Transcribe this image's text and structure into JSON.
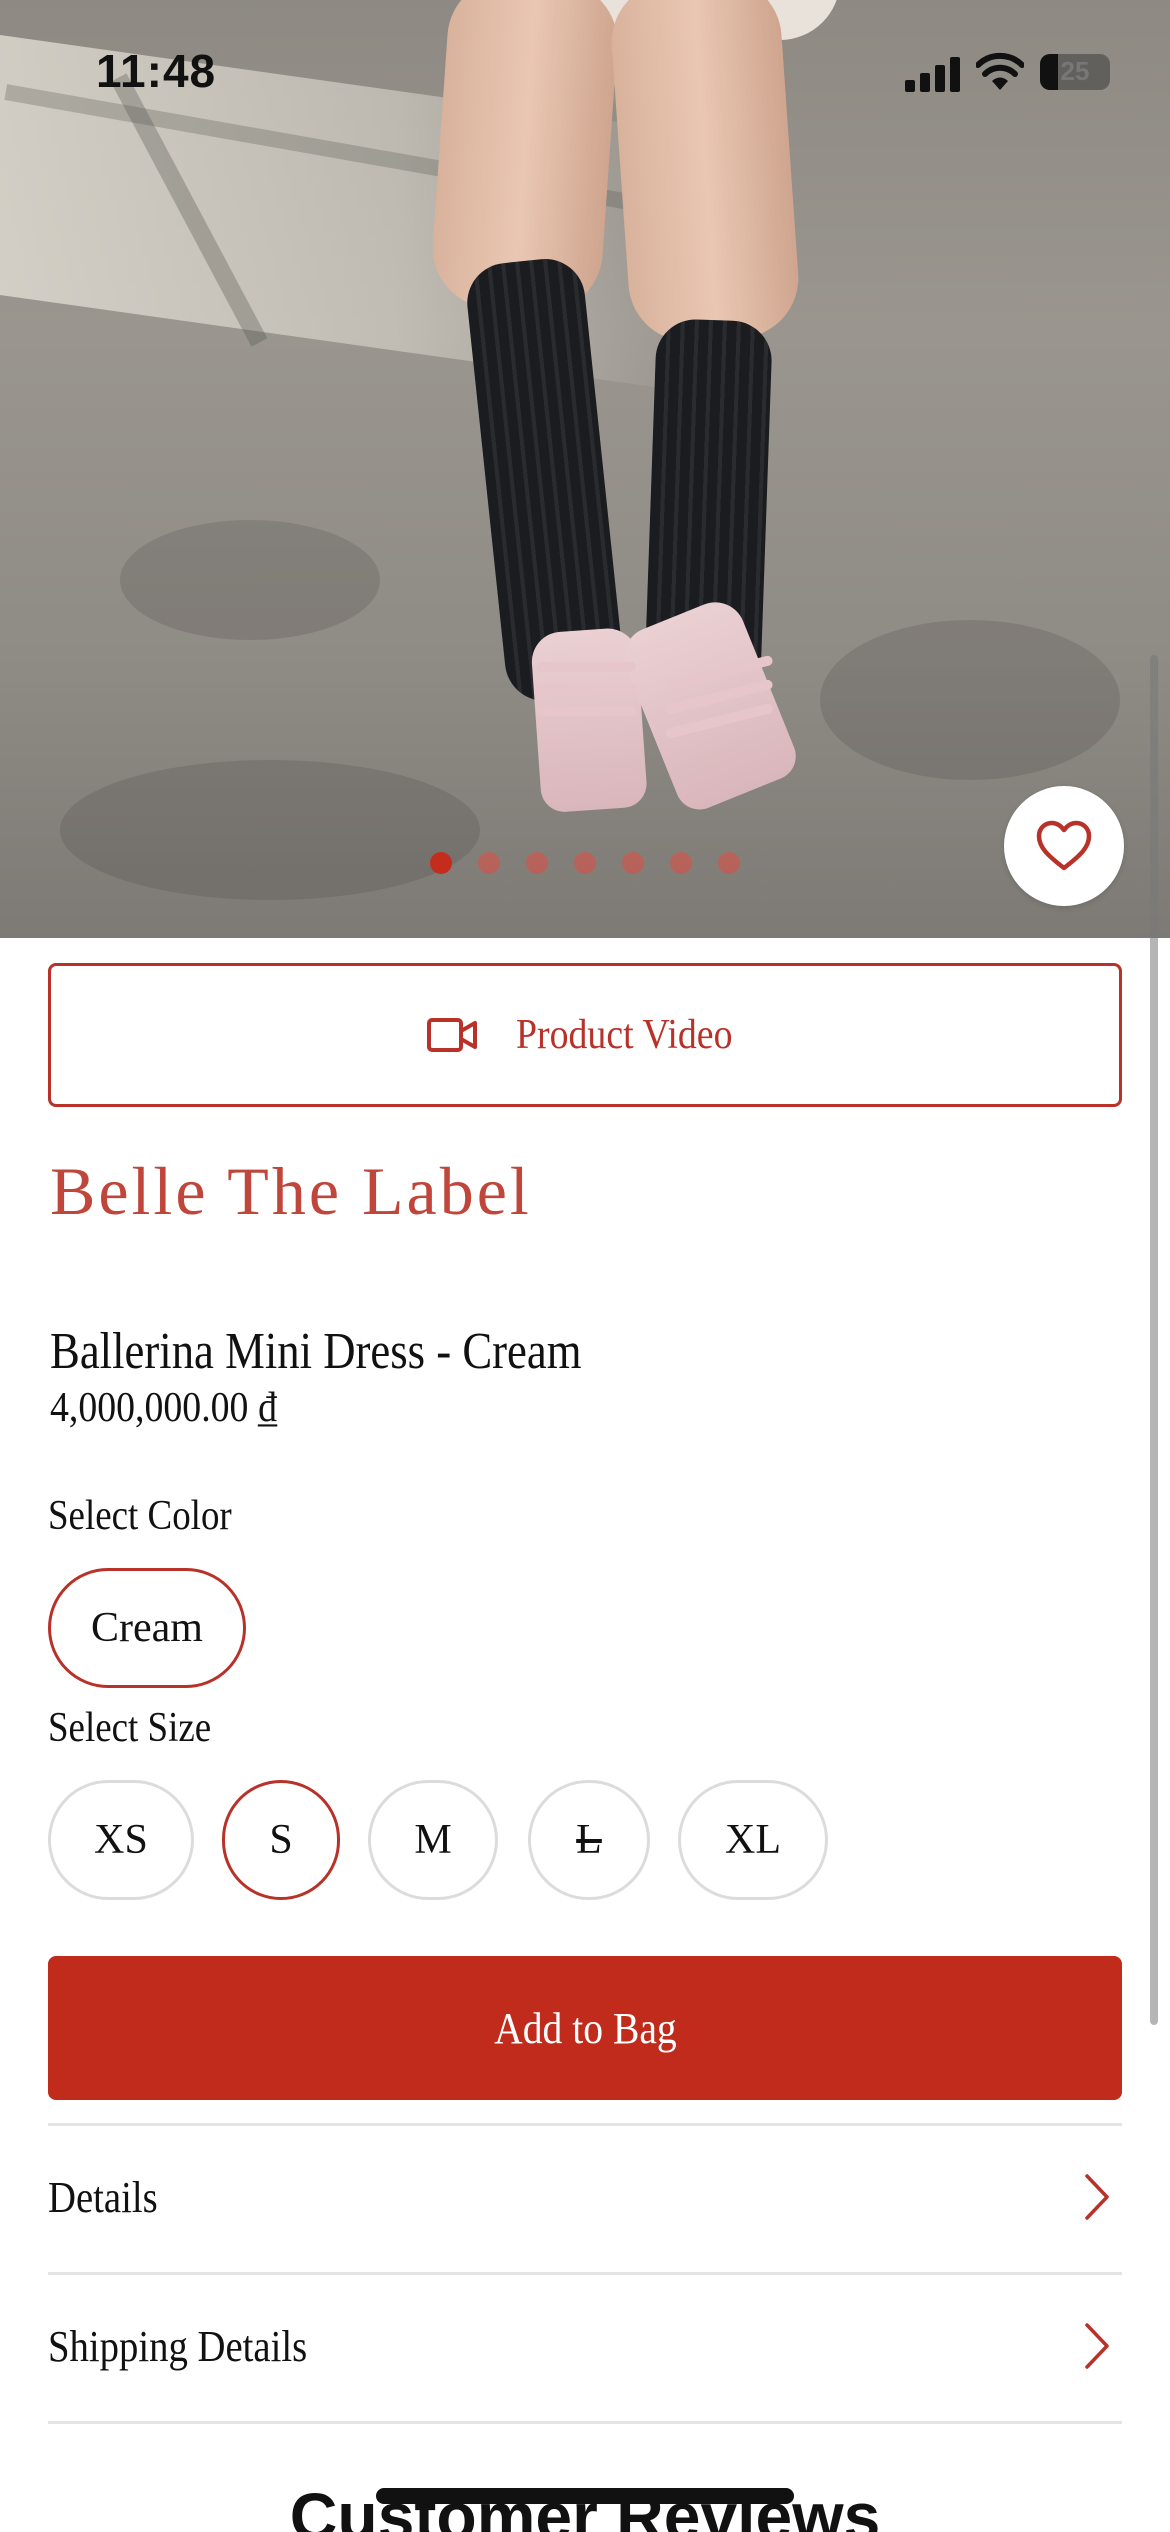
{
  "status_bar": {
    "time": "11:48",
    "battery_level": "25",
    "battery_fraction": 0.25
  },
  "product_gallery": {
    "image_count": 7,
    "active_index": 0
  },
  "product_video": {
    "label": "Product Video",
    "icon": "video-camera-icon"
  },
  "product": {
    "brand": "Belle The Label",
    "name": "Ballerina Mini Dress - Cream",
    "price": "4,000,000.00 ₫"
  },
  "color_selector": {
    "label": "Select Color",
    "options": [
      "Cream"
    ],
    "selected": "Cream"
  },
  "size_selector": {
    "label": "Select Size",
    "options": [
      "XS",
      "S",
      "M",
      "L",
      "XL"
    ],
    "selected": "S",
    "unavailable": [
      "L"
    ]
  },
  "add_to_bag": {
    "label": "Add to Bag"
  },
  "accordion": [
    {
      "label": "Details",
      "icon": "chevron-right-icon"
    },
    {
      "label": "Shipping Details",
      "icon": "chevron-right-icon"
    }
  ],
  "reviews": {
    "title": "Customer Reviews"
  },
  "colors": {
    "accent": "#c02b1c",
    "brand_text": "#c0453a",
    "dot_inactive": "#c85a50"
  }
}
